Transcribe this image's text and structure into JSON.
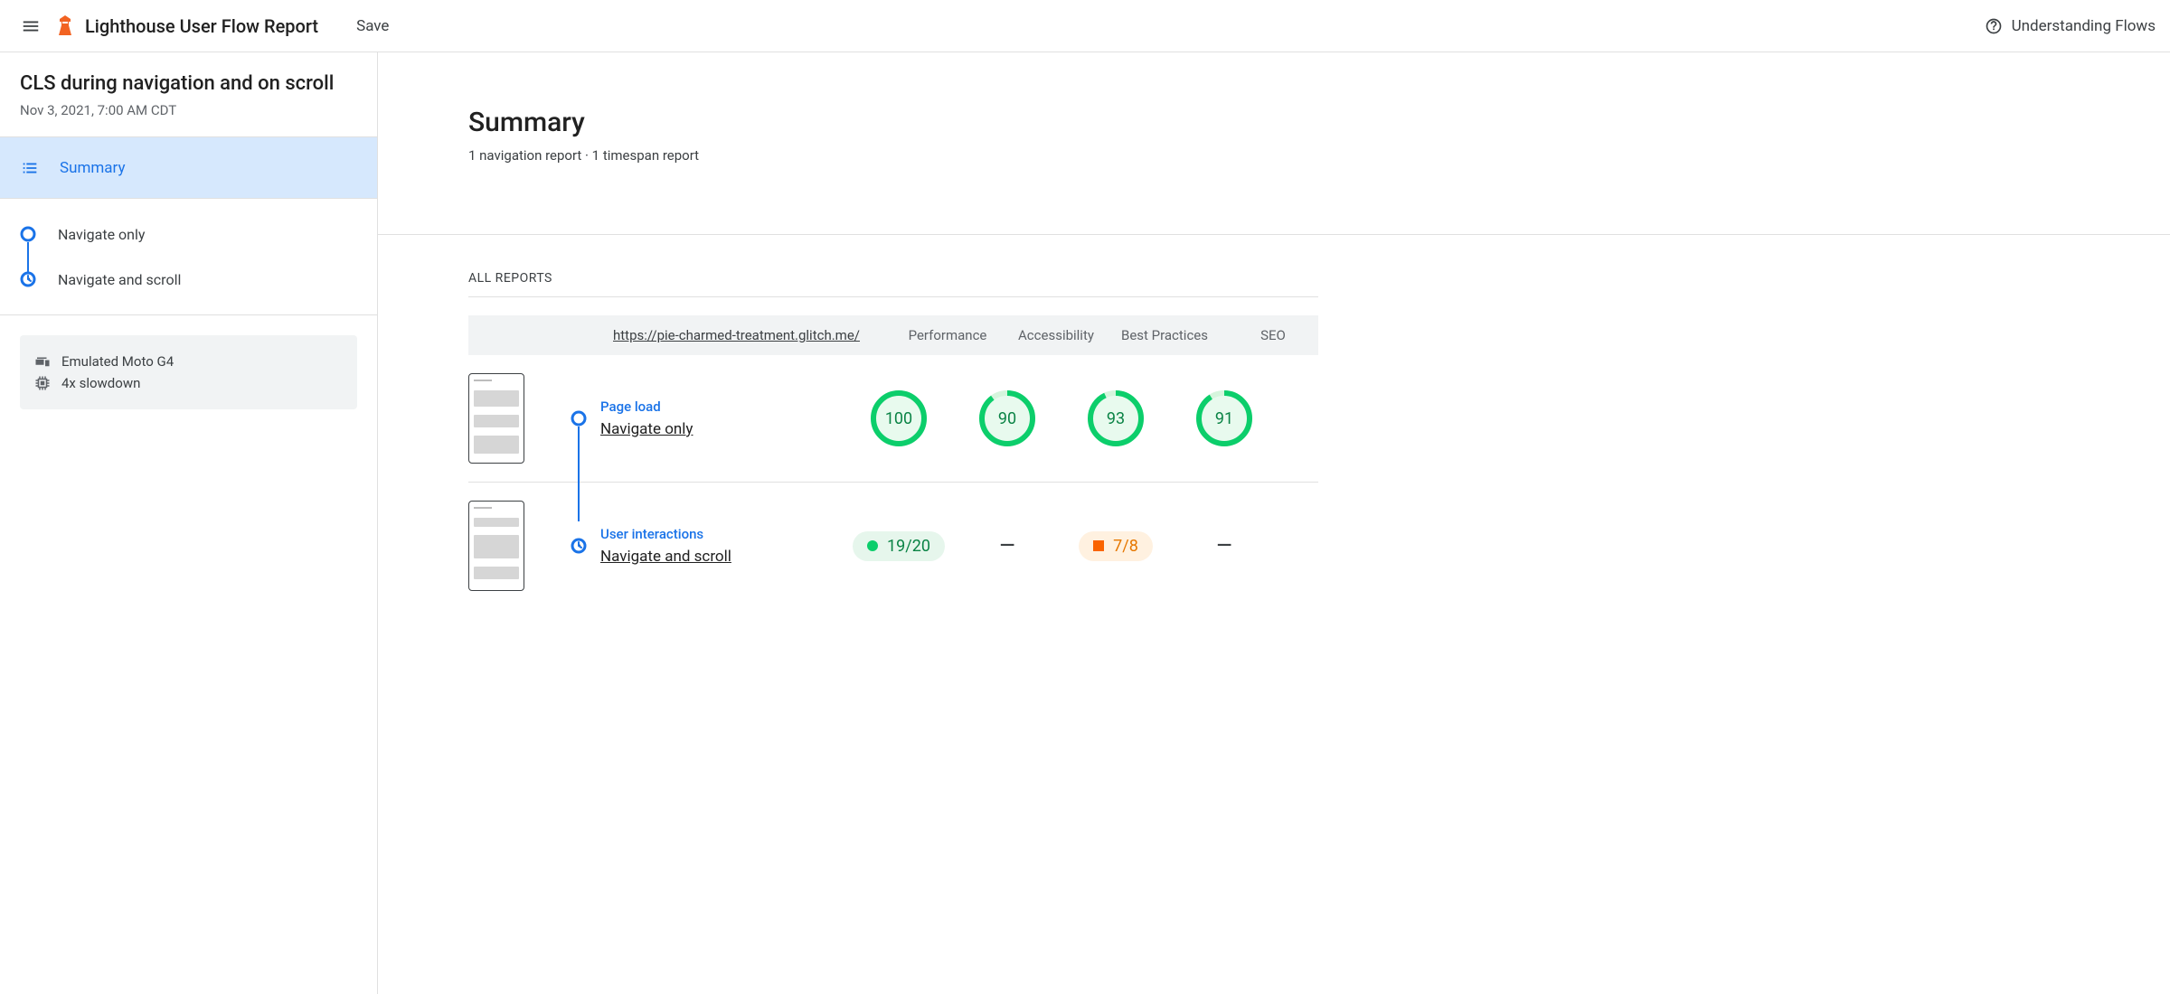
{
  "topbar": {
    "title": "Lighthouse User Flow Report",
    "save": "Save",
    "help": "Understanding Flows"
  },
  "sidebar": {
    "title": "CLS during navigation and on scroll",
    "date": "Nov 3, 2021, 7:00 AM CDT",
    "summary": "Summary",
    "steps": [
      {
        "label": "Navigate only",
        "icon": "nav"
      },
      {
        "label": "Navigate and scroll",
        "icon": "timespan"
      }
    ],
    "env": {
      "device": "Emulated Moto G4",
      "cpu": "4x slowdown"
    }
  },
  "main": {
    "title": "Summary",
    "subtitle": "1 navigation report · 1 timespan report",
    "all_reports": "ALL REPORTS",
    "columns": {
      "url": "https://pie-charmed-treatment.glitch.me/",
      "perf": "Performance",
      "a11y": "Accessibility",
      "bp": "Best Practices",
      "seo": "SEO"
    },
    "rows": [
      {
        "kind": "Page load",
        "name": "Navigate only",
        "icon": "nav",
        "scores": {
          "perf": "100",
          "a11y": "90",
          "bp": "93",
          "seo": "91"
        },
        "arcs": {
          "perf": 100,
          "a11y": 90,
          "bp": 93,
          "seo": 91
        }
      },
      {
        "kind": "User interactions",
        "name": "Navigate and scroll",
        "icon": "timespan",
        "perf_fraction": "19/20",
        "bp_fraction": "7/8"
      }
    ]
  }
}
